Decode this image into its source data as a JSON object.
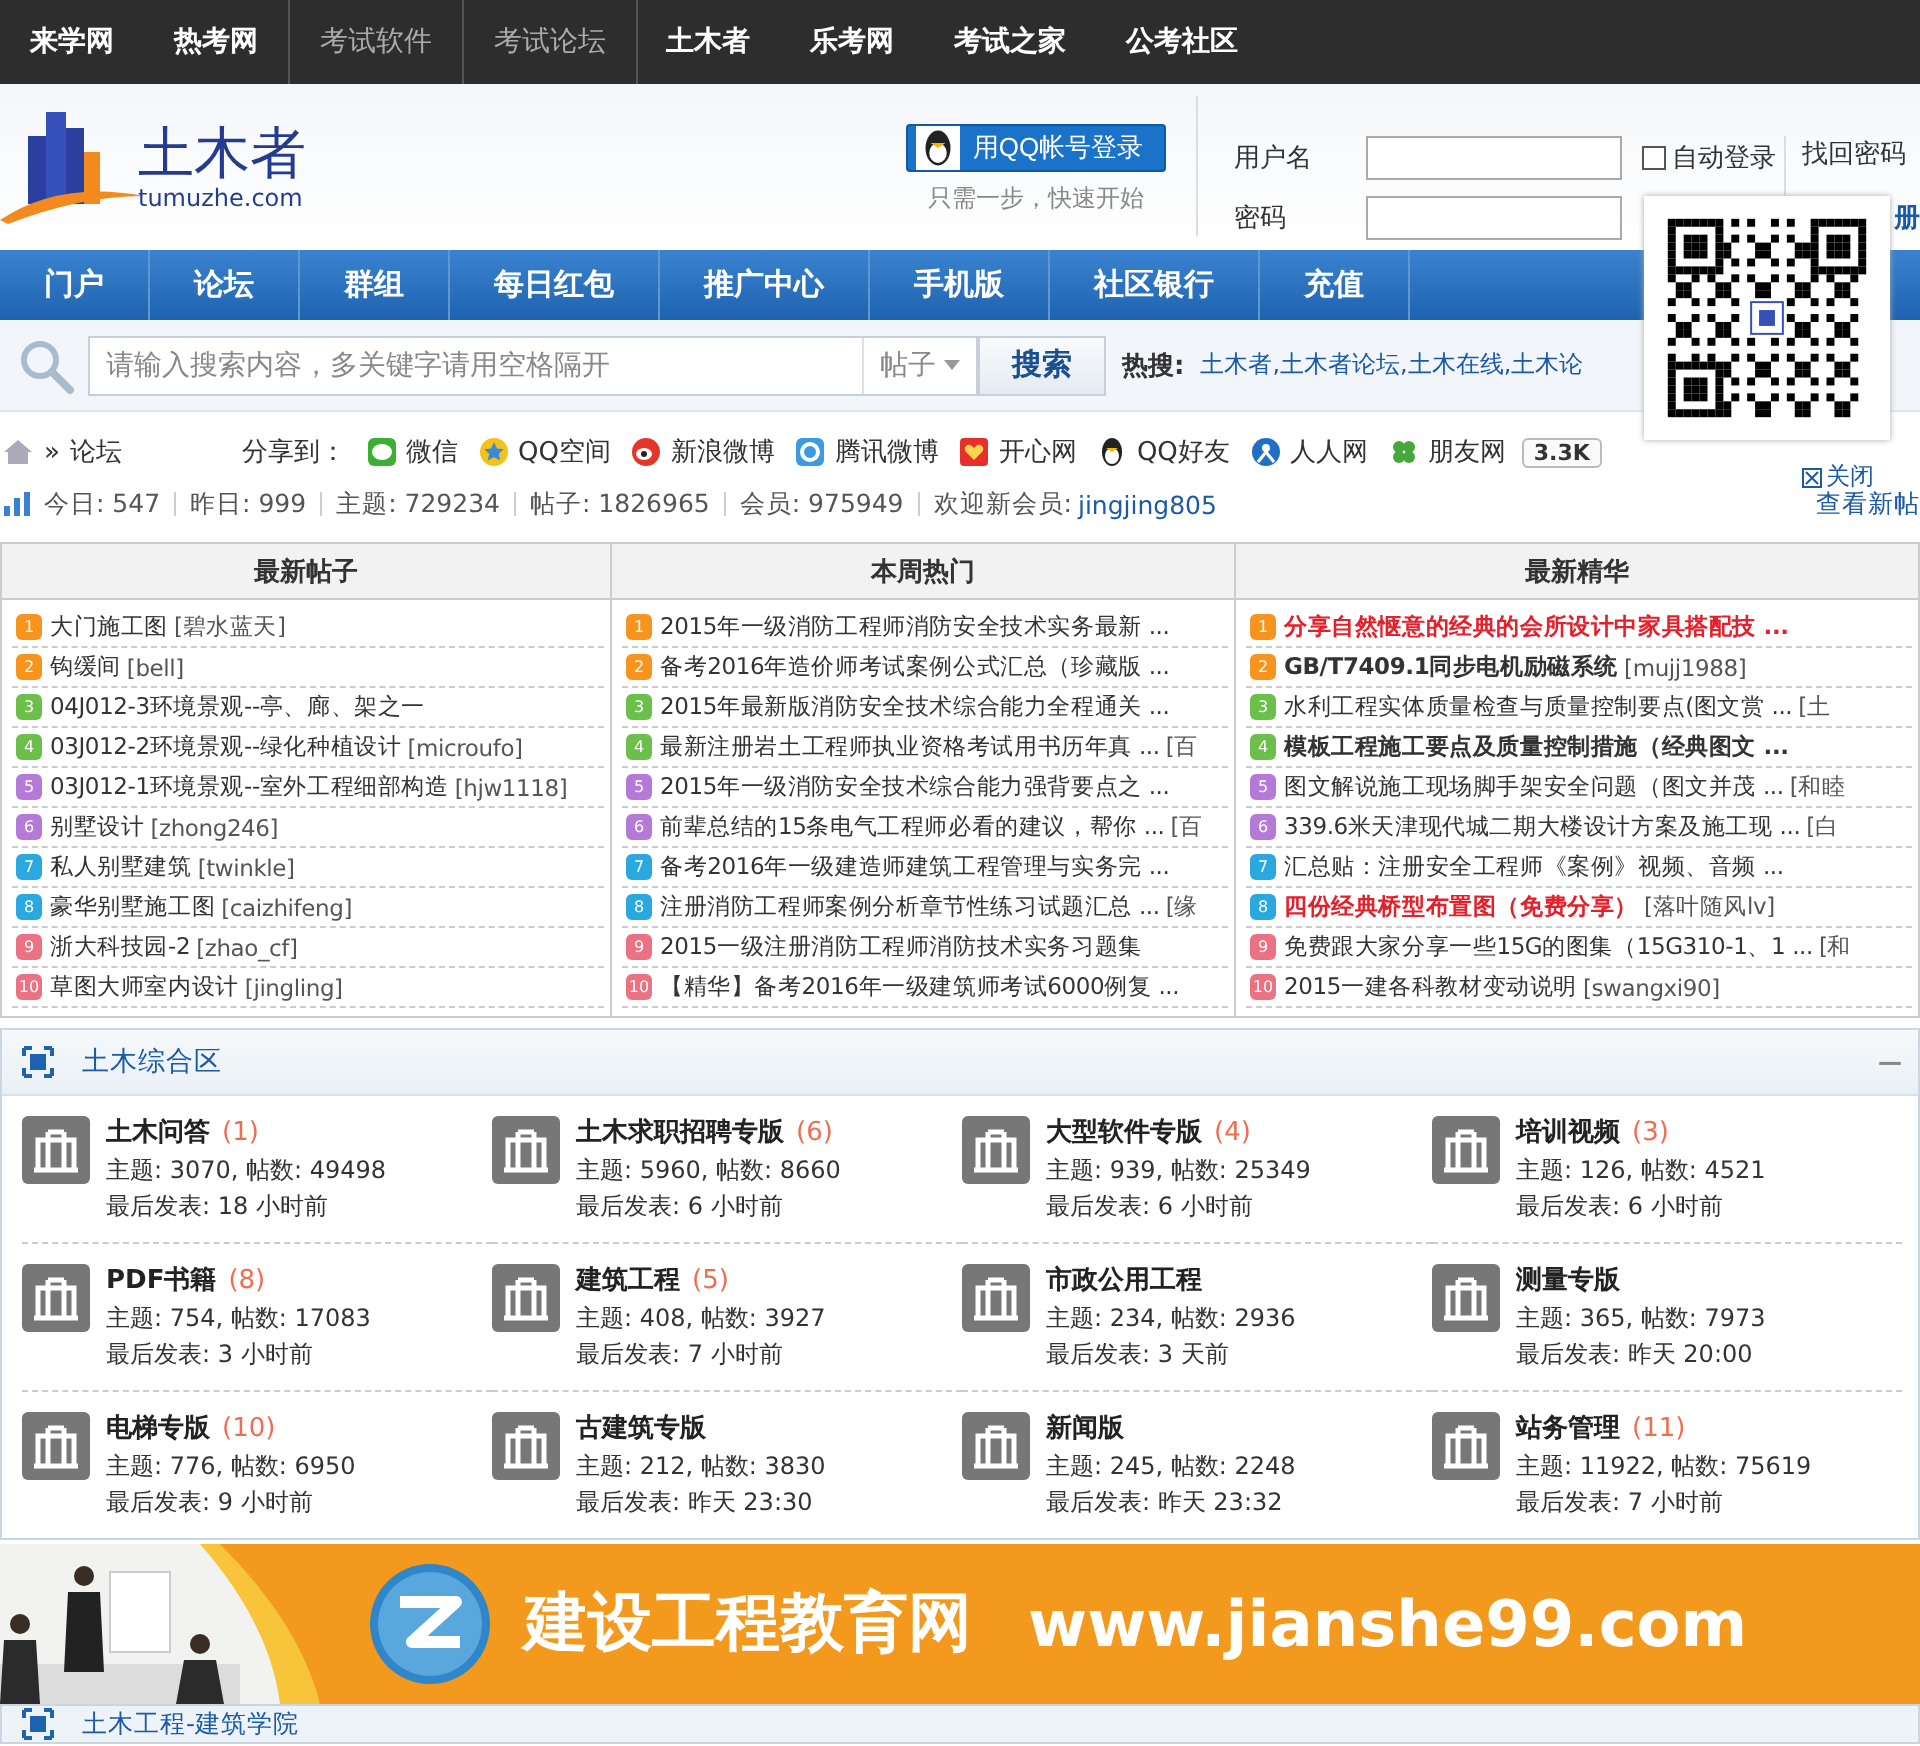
{
  "top_bar": [
    {
      "label": "来学网",
      "dim": false
    },
    {
      "label": "热考网",
      "dim": false
    },
    {
      "label": "考试软件",
      "dim": true
    },
    {
      "label": "考试论坛",
      "dim": true
    },
    {
      "label": "土木者",
      "dim": false
    },
    {
      "label": "乐考网",
      "dim": false
    },
    {
      "label": "考试之家",
      "dim": false
    },
    {
      "label": "公考社区",
      "dim": false
    }
  ],
  "logo": {
    "name": "土木者",
    "domain": "tumuzhe.com"
  },
  "login": {
    "qq_button": "用QQ帐号登录",
    "qq_hint": "只需一步，快速开始",
    "username_label": "用户名",
    "auto_login": {
      "label": "自动登录",
      "checked": false
    },
    "password_label": "密码",
    "find_password": "找回密码",
    "register": "册"
  },
  "nav": [
    "门户",
    "论坛",
    "群组",
    "每日红包",
    "推广中心",
    "手机版",
    "社区银行",
    "充值"
  ],
  "search": {
    "placeholder": "请输入搜索内容，多关键字请用空格隔开",
    "scope": "帖子",
    "button": "搜索",
    "hot_label": "热搜:",
    "hot_links": "土木者,土木者论坛,土木在线,土木论"
  },
  "qr_popup": {
    "close": "关闭"
  },
  "breadcrumb": {
    "separator": "»",
    "current": "论坛"
  },
  "share": {
    "label": "分享到：",
    "items": [
      "微信",
      "QQ空间",
      "新浪微博",
      "腾讯微博",
      "开心网",
      "QQ好友",
      "人人网",
      "朋友网"
    ],
    "count": "3.3K"
  },
  "stats": {
    "items": [
      "今日: 547",
      "昨日: 999",
      "主题: 729234",
      "帖子: 1826965",
      "会员: 975949"
    ],
    "welcome": "欢迎新会员:",
    "new_member": "jingjing805",
    "view_new": "查看新帖"
  },
  "columns": [
    {
      "title": "最新帖子",
      "items": [
        {
          "rank": "1",
          "title": "大门施工图",
          "author": "[碧水蓝天]"
        },
        {
          "rank": "2",
          "title": "钩缓间",
          "author": "[bell]"
        },
        {
          "rank": "3",
          "title": "04J012-3环境景观--亭、廊、架之一"
        },
        {
          "rank": "4",
          "title": "03J012-2环境景观--绿化种植设计",
          "author": "[microufo]"
        },
        {
          "rank": "5",
          "title": "03J012-1环境景观--室外工程细部构造",
          "author": "[hjw1118]"
        },
        {
          "rank": "6",
          "title": "别墅设计",
          "author": "[zhong246]"
        },
        {
          "rank": "7",
          "title": "私人别墅建筑",
          "author": "[twinkle]"
        },
        {
          "rank": "8",
          "title": "豪华别墅施工图",
          "author": "[caizhifeng]"
        },
        {
          "rank": "9",
          "title": "浙大科技园-2",
          "author": "[zhao_cf]"
        },
        {
          "rank": "10",
          "title": "草图大师室内设计",
          "author": "[jingling]"
        }
      ]
    },
    {
      "title": "本周热门",
      "items": [
        {
          "rank": "1",
          "title": "2015年一级消防工程师消防安全技术实务最新 ..."
        },
        {
          "rank": "2",
          "title": "备考2016年造价师考试案例公式汇总（珍藏版 ..."
        },
        {
          "rank": "3",
          "title": "2015年最新版消防安全技术综合能力全程通关 ..."
        },
        {
          "rank": "4",
          "title": "最新注册岩土工程师执业资格考试用书历年真 ...",
          "author": "[百"
        },
        {
          "rank": "5",
          "title": "2015年一级消防安全技术综合能力强背要点之 ..."
        },
        {
          "rank": "6",
          "title": "前辈总结的15条电气工程师必看的建议，帮你 ...",
          "author": "[百"
        },
        {
          "rank": "7",
          "title": "备考2016年一级建造师建筑工程管理与实务完 ..."
        },
        {
          "rank": "8",
          "title": "注册消防工程师案例分析章节性练习试题汇总 ...",
          "author": "[缘"
        },
        {
          "rank": "9",
          "title": "2015一级注册消防工程师消防技术实务习题集"
        },
        {
          "rank": "10",
          "title": "【精华】备考2016年一级建筑师考试6000例复 ..."
        }
      ]
    },
    {
      "title": "最新精华",
      "items": [
        {
          "rank": "1",
          "title": "分享自然惬意的经典的会所设计中家具搭配技 ...",
          "highlighted": true,
          "bold": true
        },
        {
          "rank": "2",
          "title": "GB/T7409.1同步电机励磁系统",
          "author": "[mujj1988]",
          "highlighted": false,
          "bold": true
        },
        {
          "rank": "3",
          "title": "水利工程实体质量检查与质量控制要点(图文赏 ...",
          "author": "[土",
          "highlighted": false,
          "bold": false
        },
        {
          "rank": "4",
          "title": "模板工程施工要点及质量控制措施（经典图文 ...",
          "highlighted": false,
          "bold": true
        },
        {
          "rank": "5",
          "title": "图文解说施工现场脚手架安全问题（图文并茂 ...",
          "author": "[和睦",
          "highlighted": false,
          "bold": false
        },
        {
          "rank": "6",
          "title": "339.6米天津现代城二期大楼设计方案及施工现 ...",
          "author": "[白",
          "highlighted": false,
          "bold": false
        },
        {
          "rank": "7",
          "title": "汇总贴：注册安全工程师《案例》视频、音频 ...",
          "highlighted": false,
          "bold": false
        },
        {
          "rank": "8",
          "title": "四份经典桥型布置图（免费分享）",
          "author": "[落叶随风lv]",
          "highlighted": true,
          "bold": true
        },
        {
          "rank": "9",
          "title": "免费跟大家分享一些15G的图集（15G310-1、1 ...",
          "author": "[和",
          "highlighted": false,
          "bold": false
        },
        {
          "rank": "10",
          "title": "2015一建各科教材变动说明",
          "author": "[swangxi90]",
          "highlighted": false,
          "bold": false
        }
      ]
    }
  ],
  "section": {
    "title": "土木综合区",
    "collapse": "—",
    "forums": [
      {
        "name": "土木问答",
        "count": "(1)",
        "stats": "主题: 3070, 帖数: 49498",
        "last": "最后发表: 18 小时前"
      },
      {
        "name": "土木求职招聘专版",
        "count": "(6)",
        "stats": "主题: 5960, 帖数: 8660",
        "last": "最后发表: 6 小时前"
      },
      {
        "name": "大型软件专版",
        "count": "(4)",
        "stats": "主题: 939, 帖数: 25349",
        "last": "最后发表: 6 小时前"
      },
      {
        "name": "培训视频",
        "count": "(3)",
        "stats": "主题: 126, 帖数: 4521",
        "last": "最后发表: 6 小时前"
      },
      {
        "name": "PDF书籍",
        "count": "(8)",
        "stats": "主题: 754, 帖数: 17083",
        "last": "最后发表: 3 小时前"
      },
      {
        "name": "建筑工程",
        "count": "(5)",
        "stats": "主题: 408, 帖数: 3927",
        "last": "最后发表: 7 小时前"
      },
      {
        "name": "市政公用工程",
        "stats": "主题: 234, 帖数: 2936",
        "last": "最后发表: 3 天前"
      },
      {
        "name": "测量专版",
        "stats": "主题: 365, 帖数: 7973",
        "last": "最后发表: 昨天 20:00"
      },
      {
        "name": "电梯专版",
        "count": "(10)",
        "stats": "主题: 776, 帖数: 6950",
        "last": "最后发表: 9 小时前"
      },
      {
        "name": "古建筑专版",
        "stats": "主题: 212, 帖数: 3830",
        "last": "最后发表: 昨天 23:30"
      },
      {
        "name": "新闻版",
        "stats": "主题: 245, 帖数: 2248",
        "last": "最后发表: 昨天 23:32"
      },
      {
        "name": "站务管理",
        "count": "(11)",
        "stats": "主题: 11922, 帖数: 75619",
        "last": "最后发表: 7 小时前"
      }
    ]
  },
  "banner": {
    "title": "建设工程教育网",
    "url": "www.jianshe99.com"
  },
  "next_section": {
    "title": "土木工程-建筑学院"
  }
}
